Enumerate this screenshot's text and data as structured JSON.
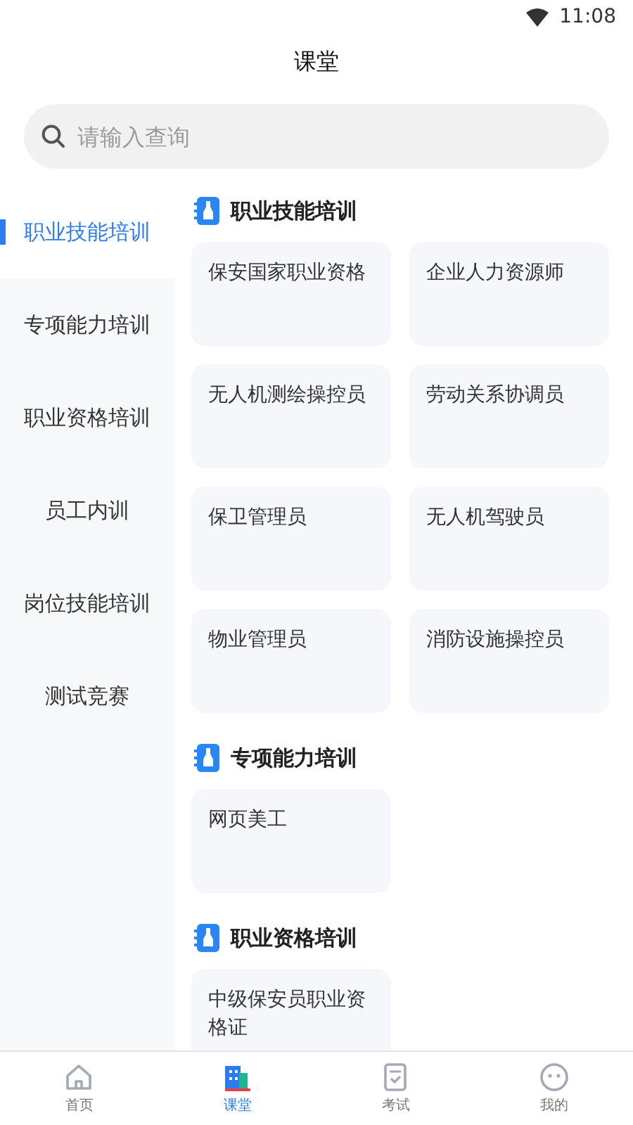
{
  "status_bar": {
    "time": "11:08"
  },
  "header": {
    "title": "课堂"
  },
  "search": {
    "placeholder": "请输入查询"
  },
  "sidebar": {
    "items": [
      {
        "label": "职业技能培训",
        "selected": true
      },
      {
        "label": "专项能力培训",
        "selected": false
      },
      {
        "label": "职业资格培训",
        "selected": false
      },
      {
        "label": "员工内训",
        "selected": false
      },
      {
        "label": "岗位技能培训",
        "selected": false
      },
      {
        "label": "测试竞赛",
        "selected": false
      }
    ]
  },
  "sections": [
    {
      "title": "职业技能培训",
      "courses": [
        "保安国家职业资格",
        "企业人力资源师",
        "无人机测绘操控员",
        "劳动关系协调员",
        "保卫管理员",
        "无人机驾驶员",
        "物业管理员",
        "消防设施操控员"
      ]
    },
    {
      "title": "专项能力培训",
      "courses": [
        "网页美工"
      ]
    },
    {
      "title": "职业资格培训",
      "courses": [
        "中级保安员职业资格证"
      ]
    }
  ],
  "tab_bar": {
    "tabs": [
      {
        "kind": "home",
        "label": "首页",
        "selected": false
      },
      {
        "kind": "classroom",
        "label": "课堂",
        "selected": true
      },
      {
        "kind": "exam",
        "label": "考试",
        "selected": false
      },
      {
        "kind": "profile",
        "label": "我的",
        "selected": false
      }
    ]
  }
}
